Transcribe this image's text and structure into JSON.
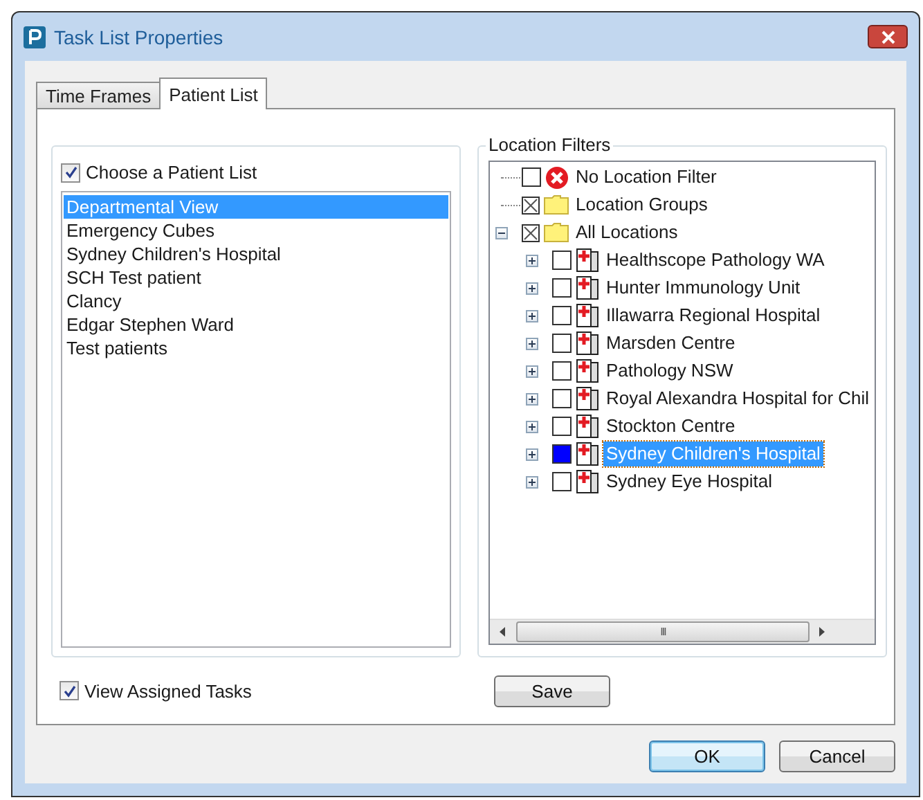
{
  "window": {
    "title": "Task List Properties"
  },
  "tabs": [
    {
      "label": "Time Frames",
      "selected": false
    },
    {
      "label": "Patient List",
      "selected": true
    }
  ],
  "patient_list": {
    "checkbox": {
      "label": "Choose a Patient List",
      "checked": true
    },
    "items": [
      {
        "label": "Departmental View",
        "selected": true
      },
      {
        "label": "Emergency Cubes",
        "selected": false
      },
      {
        "label": "Sydney Children's Hospital",
        "selected": false
      },
      {
        "label": "SCH Test patient",
        "selected": false
      },
      {
        "label": "Clancy",
        "selected": false
      },
      {
        "label": "Edgar Stephen Ward",
        "selected": false
      },
      {
        "label": "Test patients",
        "selected": false
      }
    ]
  },
  "view_assigned": {
    "label": "View Assigned Tasks",
    "checked": true
  },
  "location_filters": {
    "title": "Location Filters",
    "tree": [
      {
        "label": "No Location Filter",
        "kind": "error",
        "has_expander": false,
        "crossed": false,
        "filled": false,
        "selected": false
      },
      {
        "label": "Location Groups",
        "kind": "folder",
        "has_expander": false,
        "crossed": true,
        "filled": false,
        "selected": false
      },
      {
        "label": "All Locations",
        "kind": "folder",
        "has_expander": true,
        "expanded": true,
        "crossed": true,
        "filled": false,
        "selected": false,
        "children": [
          {
            "label": "Healthscope Pathology WA",
            "kind": "hospital",
            "has_expander": true,
            "expanded": false,
            "crossed": false,
            "filled": false,
            "selected": false
          },
          {
            "label": "Hunter Immunology Unit",
            "kind": "hospital",
            "has_expander": true,
            "expanded": false,
            "crossed": false,
            "filled": false,
            "selected": false
          },
          {
            "label": "Illawarra Regional Hospital",
            "kind": "hospital",
            "has_expander": true,
            "expanded": false,
            "crossed": false,
            "filled": false,
            "selected": false
          },
          {
            "label": "Marsden Centre",
            "kind": "hospital",
            "has_expander": true,
            "expanded": false,
            "crossed": false,
            "filled": false,
            "selected": false
          },
          {
            "label": "Pathology NSW",
            "kind": "hospital",
            "has_expander": true,
            "expanded": false,
            "crossed": false,
            "filled": false,
            "selected": false
          },
          {
            "label": "Royal Alexandra Hospital for Chil",
            "kind": "hospital",
            "has_expander": true,
            "expanded": false,
            "crossed": false,
            "filled": false,
            "selected": false
          },
          {
            "label": "Stockton Centre",
            "kind": "hospital",
            "has_expander": true,
            "expanded": false,
            "crossed": false,
            "filled": false,
            "selected": false
          },
          {
            "label": "Sydney Children's Hospital",
            "kind": "hospital",
            "has_expander": true,
            "expanded": false,
            "crossed": false,
            "filled": true,
            "selected": true
          },
          {
            "label": "Sydney Eye Hospital",
            "kind": "hospital",
            "has_expander": true,
            "expanded": false,
            "crossed": false,
            "filled": false,
            "selected": false
          }
        ]
      }
    ],
    "scrollbar_grip": "III"
  },
  "save_button": "Save",
  "buttons": [
    {
      "label": "OK",
      "kind": "default"
    },
    {
      "label": "Cancel",
      "kind": "normal"
    }
  ]
}
